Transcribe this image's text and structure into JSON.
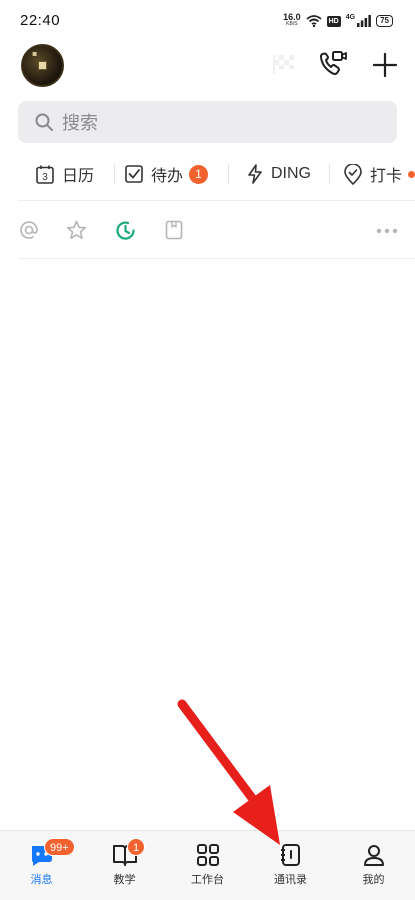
{
  "status_bar": {
    "time": "22:40",
    "net_speed_value": "16.0",
    "net_speed_unit": "KB/S",
    "hd_label": "HD",
    "network_label": "4G",
    "battery_level": "75"
  },
  "top_bar": {
    "icons": [
      "coin-avatar",
      "flag-icon",
      "video-call-icon",
      "plus-icon"
    ]
  },
  "search": {
    "placeholder": "搜索"
  },
  "shortcuts": {
    "calendar_day": "3",
    "calendar_label": "日历",
    "todo_label": "待办",
    "todo_badge": "1",
    "ding_label": "DING",
    "checkin_label": "打卡"
  },
  "filters": {
    "icons": [
      "at-icon",
      "star-icon",
      "clock-icon",
      "bookmark-icon",
      "more-icon"
    ]
  },
  "tabs": [
    {
      "label": "消息",
      "badge": "99+",
      "active": true
    },
    {
      "label": "教学",
      "badge": "1",
      "active": false
    },
    {
      "label": "工作台",
      "badge": "",
      "active": false
    },
    {
      "label": "通讯录",
      "badge": "",
      "active": false
    },
    {
      "label": "我的",
      "badge": "",
      "active": false
    }
  ],
  "colors": {
    "accent_blue": "#1677ff",
    "badge_orange": "#f2622e",
    "active_green": "#1aaa7e",
    "arrow_red": "#e8201c"
  }
}
